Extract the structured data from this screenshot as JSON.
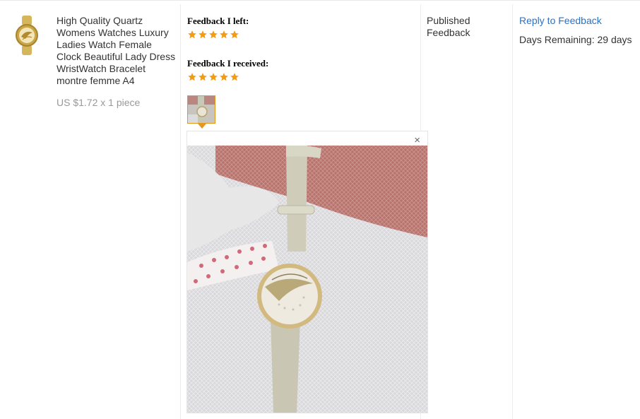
{
  "product": {
    "title": "High Quality Quartz Womens Watches Luxury Ladies Watch Female Clock Beautiful Lady Dress WristWatch Bracelet montre femme A4",
    "price": "US $1.72 x 1 piece",
    "thumbnail_icon": "gold-watch-icon"
  },
  "feedback": {
    "left_label": "Feedback I left:",
    "left_stars": 5,
    "received_label": "Feedback I received:",
    "received_stars": 5,
    "star_color": "#f39c12"
  },
  "photo_viewer": {
    "close_icon": "close-icon",
    "close_glyph": "×"
  },
  "status": {
    "text": "Published Feedback"
  },
  "actions": {
    "reply_label": "Reply to Feedback",
    "reply_color": "#2a72c5",
    "days_remaining": "Days Remaining: 29 days"
  }
}
